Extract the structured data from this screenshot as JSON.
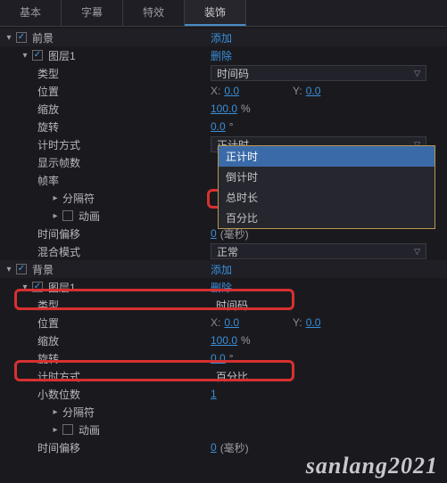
{
  "tabs": {
    "basic": "基本",
    "subtitle": "字幕",
    "fx": "特效",
    "deco": "装饰"
  },
  "actions": {
    "add": "添加",
    "delete": "删除"
  },
  "sections": {
    "fg": "前景",
    "bg": "背景",
    "layer1": "图层1"
  },
  "props": {
    "type": "类型",
    "position": "位置",
    "scale": "缩放",
    "rotation": "旋转",
    "timing_method": "计时方式",
    "show_frames": "显示帧数",
    "frame_rate": "帧率",
    "separator": "分隔符",
    "animation": "动画",
    "time_offset": "时间偏移",
    "blend_mode": "混合模式",
    "decimal_places": "小数位数"
  },
  "values": {
    "timecode": "时间码",
    "pos_x": "0.0",
    "pos_y": "0.0",
    "x_l": "X:",
    "y_l": "Y:",
    "scale": "100.0",
    "pct": "%",
    "deg": "°",
    "rotation": "0.0",
    "count_up": "正计时",
    "percent": "百分比",
    "offset_zero": "0",
    "ms_suffix": "(毫秒)",
    "blend_normal": "正常",
    "decimals": "1"
  },
  "timing_options": [
    "正计时",
    "倒计时",
    "总时长",
    "百分比"
  ],
  "watermark": "sanlang2021"
}
